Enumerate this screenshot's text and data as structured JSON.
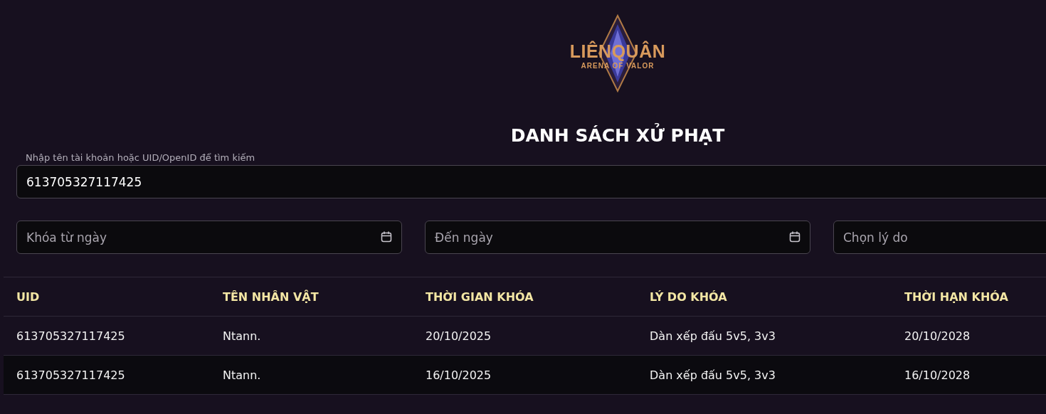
{
  "logo": {
    "title": "LIÊNQUÂN",
    "subtitle": "ARENA OF VALOR"
  },
  "heading": "DANH SÁCH XỬ PHẠT",
  "search": {
    "label": "Nhập tên tài khoản hoặc UID/OpenID để tìm kiếm",
    "value": "613705327117425"
  },
  "filters": [
    {
      "kind": "date",
      "placeholder": "Khóa từ ngày"
    },
    {
      "kind": "date",
      "placeholder": "Đến ngày"
    },
    {
      "kind": "select",
      "placeholder": "Chọn lý do"
    }
  ],
  "table": {
    "columns": [
      "UID",
      "TÊN NHÂN VẬT",
      "THỜI GIAN KHÓA",
      "LÝ DO KHÓA",
      "THỜI HẠN KHÓA"
    ],
    "rows": [
      [
        "613705327117425",
        "Ntann.",
        "20/10/2025",
        "Dàn xếp đấu 5v5, 3v3",
        "20/10/2028"
      ],
      [
        "613705327117425",
        "Ntann.",
        "16/10/2025",
        "Dàn xếp đấu 5v5, 3v3",
        "16/10/2028"
      ]
    ]
  }
}
